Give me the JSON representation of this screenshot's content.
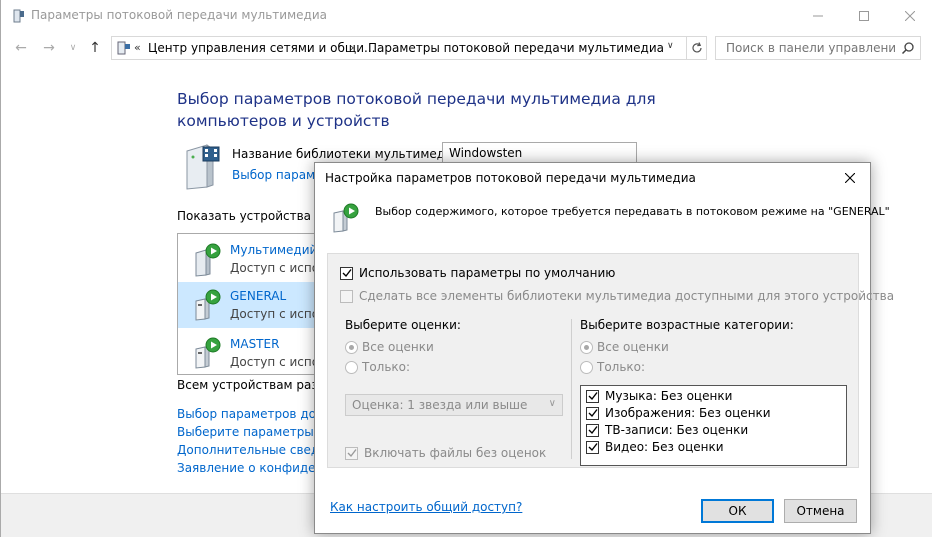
{
  "window": {
    "title": "Параметры потоковой передачи мультимедиа"
  },
  "address": {
    "crumb1": "Центр управления сетями и общи...",
    "crumb2": "Параметры потоковой передачи мультимедиа",
    "crumb_prefix": "«"
  },
  "search": {
    "placeholder": "Поиск в панели управления"
  },
  "main": {
    "heading": "Выбор параметров потоковой передачи мультимедиа для компьютеров и устройств",
    "library_label": "Название библиотеки мультимедиа:",
    "library_value": "Windowsten",
    "library_link": "Выбор парамет",
    "show_devices_label": "Показать устройства на:",
    "all_devices_text": "Всем устройствам разре",
    "links": [
      "Выбор параметров дома",
      "Выберите параметры эле",
      "Дополнительные сведен",
      "Заявление о конфиденц"
    ]
  },
  "devices": [
    {
      "name": "Мультимедийн",
      "status": "Доступ с испол",
      "selected": false
    },
    {
      "name": "GENERAL",
      "status": "Доступ с испол",
      "selected": true
    },
    {
      "name": "MASTER",
      "status": "Доступ с испол",
      "selected": false
    }
  ],
  "dialog": {
    "title": "Настройка параметров потоковой передачи мультимедиа",
    "description": "Выбор содержимого, которое требуется передавать в потоковом режиме на \"GENERAL\"",
    "use_defaults": "Использовать параметры по умолчанию",
    "use_defaults_checked": true,
    "make_all_available": "Сделать все элементы библиотеки мультимедиа доступными для этого устройства",
    "ratings_title": "Выберите оценки:",
    "ratings_all": "Все оценки",
    "ratings_only": "Только:",
    "ratings_select": "Оценка: 1 звезда или выше",
    "include_unrated": "Включать файлы без оценок",
    "age_title": "Выберите возрастные категории:",
    "age_all": "Все оценки",
    "age_only": "Только:",
    "age_items": [
      "Музыка: Без оценки",
      "Изображения: Без оценки",
      "ТВ-записи: Без оценки",
      "Видео: Без оценки"
    ],
    "help_link": "Как настроить общий доступ?",
    "ok_label": "ОК",
    "cancel_label": "Отмена"
  }
}
